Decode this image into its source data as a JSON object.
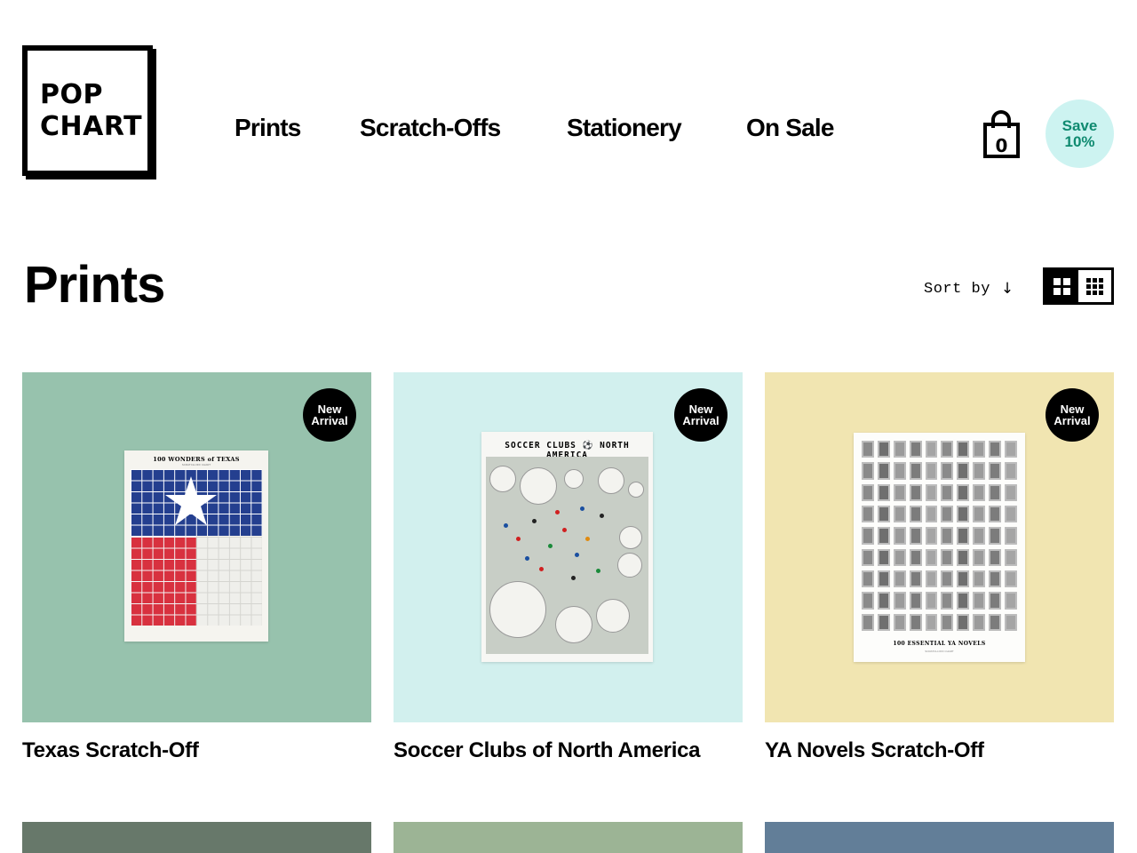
{
  "brand": {
    "logo_line1": "POP",
    "logo_line2": "CHART"
  },
  "nav": {
    "items": [
      "Prints",
      "Scratch-Offs",
      "Stationery",
      "On Sale"
    ]
  },
  "cart": {
    "count": "0"
  },
  "promo": {
    "line1": "Save",
    "line2": "10%"
  },
  "page": {
    "title": "Prints"
  },
  "sort": {
    "label": "Sort by",
    "arrow": "↓"
  },
  "view": {
    "active": "large-grid",
    "options": [
      "large-grid",
      "small-grid"
    ]
  },
  "colors": {
    "save_bg": "#cdf3f1",
    "save_text": "#0f8a70"
  },
  "products": [
    {
      "name": "Texas Scratch-Off",
      "badge_line1": "New",
      "badge_line2": "Arrival",
      "bg": "#97c2ad",
      "poster_title": "100 WONDERS of TEXAS",
      "poster_subtitle": "SCRATCH-OFF CHART"
    },
    {
      "name": "Soccer Clubs of North America",
      "badge_line1": "New",
      "badge_line2": "Arrival",
      "bg": "#d2f0ee",
      "poster_title": "SOCCER CLUBS ⚽ NORTH AMERICA"
    },
    {
      "name": "YA Novels Scratch-Off",
      "badge_line1": "New",
      "badge_line2": "Arrival",
      "bg": "#f1e5b1",
      "poster_title": "100 ESSENTIAL YA NOVELS",
      "poster_subtitle": "SCRATCH-OFF CHART"
    }
  ],
  "next_row_colors": [
    "#67786a",
    "#9cb495",
    "#627e98"
  ]
}
